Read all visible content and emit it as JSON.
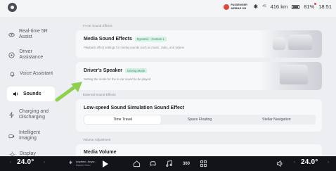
{
  "status": {
    "airbag_text": "PASSENGER AIRBAG ON",
    "range": "416 km",
    "battery": "81%",
    "time": "18:51",
    "icons": [
      "car-logo-icon",
      "airbag-icon",
      "bluetooth-icon",
      "signal-icon",
      "battery-icon"
    ]
  },
  "sidebar": {
    "items": [
      {
        "label": "Real-time 5R Assist",
        "icon": "eye-icon"
      },
      {
        "label": "Driver Assistance",
        "icon": "steering-icon"
      },
      {
        "label": "Voice Assistant",
        "icon": "bell-icon"
      },
      {
        "label": "Sounds",
        "icon": "speaker-icon",
        "active": true
      },
      {
        "label": "Charging and Discharging",
        "icon": "charging-icon"
      },
      {
        "label": "Intelligent Imaging",
        "icon": "camera-icon"
      },
      {
        "label": "Display",
        "icon": "brightness-icon"
      }
    ]
  },
  "main": {
    "section1": "In-car Sound Effects",
    "media_effects": {
      "title": "Media Sound Effects",
      "tag": "Dynamic · Custom 1",
      "sub": "Playback effect settings for media sounds such as music, radio, and videos"
    },
    "drivers_speaker": {
      "title": "Driver's Speaker",
      "tag": "Driving Mode",
      "sub": "Setting the mode for the in-car sound to be played"
    },
    "section2": "External Sound Effects",
    "low_speed": {
      "title": "Low-speed Sound Simulation Sound Effect",
      "options": [
        "Time Travel",
        "Space Floating",
        "Stellar Navigation"
      ],
      "selected": "Time Travel"
    },
    "section3": "Volume Adjustment",
    "media_volume": {
      "title": "Media Volume"
    }
  },
  "bottom": {
    "left_temp": "24.0°",
    "right_temp": "24.0°",
    "music_line1": "Anytime, Anyw...",
    "music_line2": "Daniel Kuiu",
    "dock_text": "360",
    "dock_icons": [
      "home-icon",
      "car-icon",
      "music-icon",
      "camera-360-icon",
      "apps-icon",
      "volume-icon"
    ]
  }
}
